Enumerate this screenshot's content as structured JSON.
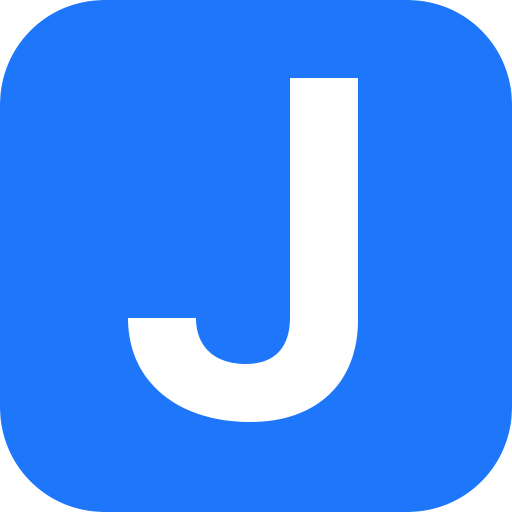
{
  "icon": {
    "name": "app-icon-letter-j",
    "letter": "J",
    "background_color": "#1e77fb",
    "letter_color": "#ffffff"
  }
}
